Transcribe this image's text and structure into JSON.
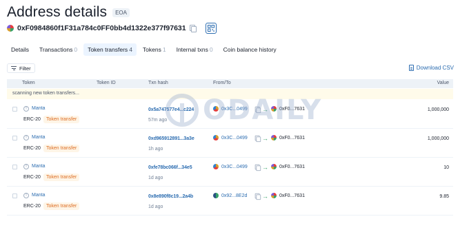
{
  "header": {
    "title": "Address details",
    "badge": "EOA",
    "address": "0xF0984860f1F31a784c0FF0bb4d1322e377f97631"
  },
  "tabs": [
    {
      "label": "Details",
      "count": ""
    },
    {
      "label": "Transactions",
      "count": "0"
    },
    {
      "label": "Token transfers",
      "count": "4"
    },
    {
      "label": "Tokens",
      "count": "1"
    },
    {
      "label": "Internal txns",
      "count": "0"
    },
    {
      "label": "Coin balance history",
      "count": ""
    }
  ],
  "toolbar": {
    "filter_label": "Filter",
    "download_label": "Download CSV"
  },
  "table": {
    "columns": [
      "Token",
      "Token ID",
      "Txn hash",
      "From/To",
      "Value"
    ],
    "notice": "scanning new token transfers...",
    "rows": [
      {
        "token": "Manta",
        "standard": "ERC-20",
        "type": "Token transfer",
        "hash": "0x5a747577e4...c224",
        "age": "57m ago",
        "from": "0x3C...0499",
        "to": "0xF0...7631",
        "value": "1,000,000"
      },
      {
        "token": "Manta",
        "standard": "ERC-20",
        "type": "Token transfer",
        "hash": "0xd965912891...3a3e",
        "age": "1h ago",
        "from": "0x3C...0499",
        "to": "0xF0...7631",
        "value": "1,000,000"
      },
      {
        "token": "Manta",
        "standard": "ERC-20",
        "type": "Token transfer",
        "hash": "0xfe78bc066f...34e5",
        "age": "1d ago",
        "from": "0x3C...0499",
        "to": "0xF0...7631",
        "value": "10"
      },
      {
        "token": "Manta",
        "standard": "ERC-20",
        "type": "Token transfer",
        "hash": "0x8e890f8c19...2a4b",
        "age": "1d ago",
        "from": "0x92...8E2d",
        "to": "0xF0...7631",
        "value": "9.85"
      }
    ]
  },
  "watermark": {
    "text": "ODAILY"
  },
  "colors": {
    "link": "#2b6cb0",
    "accent_tab": "#ebf4ff",
    "transfer_badge": "#dd6b20",
    "notice_bg": "#fffbea"
  }
}
